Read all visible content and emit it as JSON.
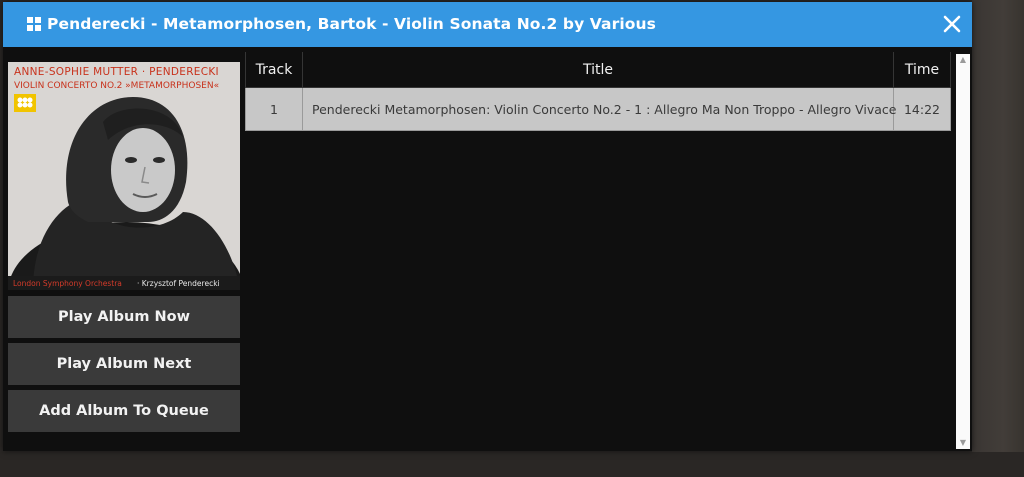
{
  "header": {
    "title": "Penderecki - Metamorphosen, Bartok - Violin Sonata No.2 by Various",
    "close_label": "close"
  },
  "cover": {
    "line1": "ANNE-SOPHIE MUTTER · PENDERECKI",
    "line2": "VIOLIN CONCERTO NO.2 »METAMORPHOSEN«",
    "footer_orchestra": "London Symphony Orchestra",
    "footer_conductor": "· Krzysztof Penderecki"
  },
  "actions": {
    "play_now": "Play Album Now",
    "play_next": "Play Album Next",
    "add_queue": "Add Album To Queue"
  },
  "table": {
    "headers": {
      "track": "Track",
      "title": "Title",
      "time": "Time"
    },
    "rows": [
      {
        "track": "1",
        "title": "Penderecki Metamorphosen: Violin Concerto No.2 - 1 : Allegro Ma Non Troppo - Allegro Vivace",
        "time": "14:22"
      }
    ]
  },
  "colors": {
    "header_bg": "#3597e2",
    "row_bg": "#c7c7c7",
    "button_bg": "#3a3a3a"
  }
}
